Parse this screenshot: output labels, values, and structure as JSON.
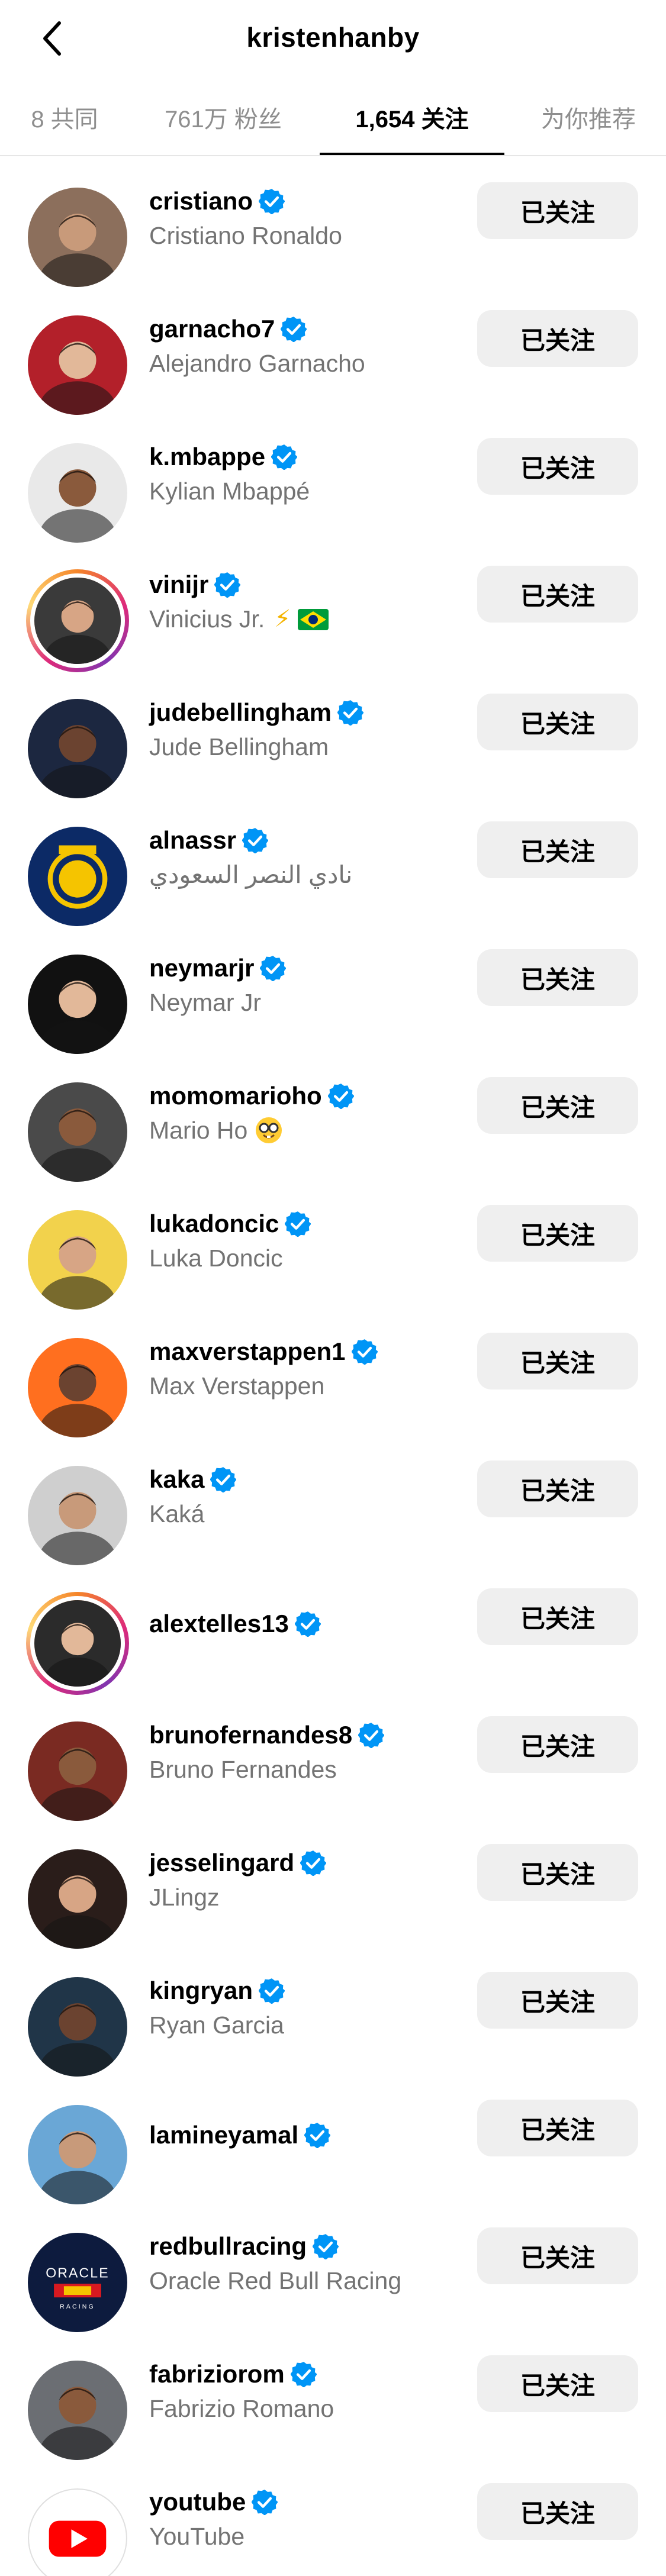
{
  "header": {
    "title": "kristenhanby",
    "back_icon": "chevron-left-icon"
  },
  "tabs": [
    {
      "label": "8 共同",
      "active": false
    },
    {
      "label": "761万 粉丝",
      "active": false
    },
    {
      "label": "1,654 关注",
      "active": true
    },
    {
      "label": "为你推荐",
      "active": false
    }
  ],
  "follow_label": "已关注",
  "accounts": [
    {
      "username": "cristiano",
      "full_name": "Cristiano Ronaldo",
      "verified": true,
      "story_ring": false,
      "avatar_color": "#8c6f5c"
    },
    {
      "username": "garnacho7",
      "full_name": "Alejandro Garnacho",
      "verified": true,
      "story_ring": false,
      "avatar_color": "#b3202a"
    },
    {
      "username": "k.mbappe",
      "full_name": "Kylian Mbappé",
      "verified": true,
      "story_ring": false,
      "avatar_color": "#e9e9e9"
    },
    {
      "username": "vinijr",
      "full_name": "Vinicius Jr.",
      "verified": true,
      "story_ring": true,
      "avatar_color": "#3a3a3a",
      "suffix": "⚡",
      "flag": "brazil"
    },
    {
      "username": "judebellingham",
      "full_name": "Jude Bellingham",
      "verified": true,
      "story_ring": false,
      "avatar_color": "#1c2740"
    },
    {
      "username": "alnassr",
      "full_name": "نادي النصر السعودي",
      "verified": true,
      "story_ring": false,
      "avatar_color": "#0c2a66"
    },
    {
      "username": "neymarjr",
      "full_name": "Neymar Jr",
      "verified": true,
      "story_ring": false,
      "avatar_color": "#111111"
    },
    {
      "username": "momomarioho",
      "full_name": "Mario Ho",
      "verified": true,
      "story_ring": false,
      "avatar_color": "#4a4a4a",
      "emoji": "nerd-face"
    },
    {
      "username": "lukadoncic",
      "full_name": "Luka Doncic",
      "verified": true,
      "story_ring": false,
      "avatar_color": "#f2d24c"
    },
    {
      "username": "maxverstappen1",
      "full_name": "Max Verstappen",
      "verified": true,
      "story_ring": false,
      "avatar_color": "#ff6f1f"
    },
    {
      "username": "kaka",
      "full_name": "Kaká",
      "verified": true,
      "story_ring": false,
      "avatar_color": "#cfcfcf"
    },
    {
      "username": "alextelles13",
      "full_name": "",
      "verified": true,
      "story_ring": true,
      "avatar_color": "#2b2b2b"
    },
    {
      "username": "brunofernandes8",
      "full_name": "Bruno Fernandes",
      "verified": true,
      "story_ring": false,
      "avatar_color": "#7a2a22"
    },
    {
      "username": "jesselingard",
      "full_name": "JLingz",
      "verified": true,
      "story_ring": false,
      "avatar_color": "#2a1d1a"
    },
    {
      "username": "kingryan",
      "full_name": "Ryan Garcia",
      "verified": true,
      "story_ring": false,
      "avatar_color": "#203548"
    },
    {
      "username": "lamineyamal",
      "full_name": "",
      "verified": true,
      "story_ring": false,
      "avatar_color": "#6aa7d6"
    },
    {
      "username": "redbullracing",
      "full_name": "Oracle Red Bull Racing",
      "verified": true,
      "story_ring": false,
      "avatar_color": "#0d1b3e",
      "logo_text": "ORACLE"
    },
    {
      "username": "fabriziorom",
      "full_name": "Fabrizio Romano",
      "verified": true,
      "story_ring": false,
      "avatar_color": "#6b6e73"
    },
    {
      "username": "youtube",
      "full_name": "YouTube",
      "verified": true,
      "story_ring": false,
      "avatar_color": "#ffffff"
    }
  ],
  "colors": {
    "verified_badge": "#0095f6",
    "follow_button_bg": "#efefef",
    "secondary_text": "#737373"
  }
}
